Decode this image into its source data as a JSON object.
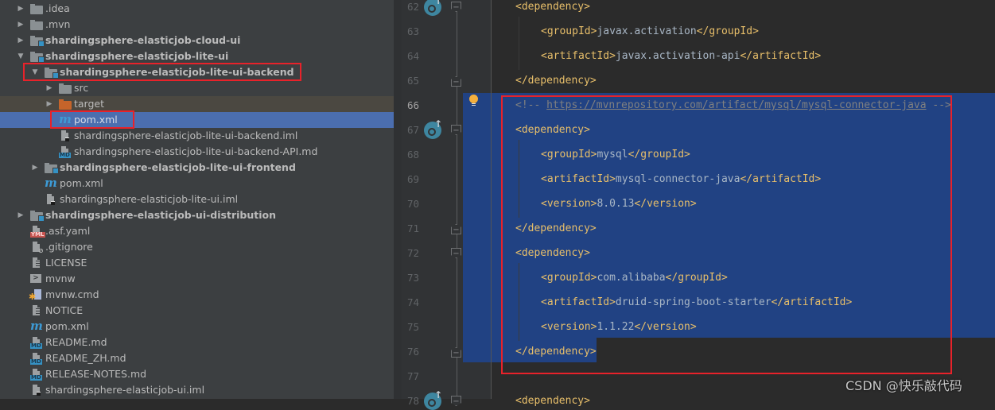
{
  "tree": {
    "items": [
      {
        "label": ".idea",
        "icon": "folder-icon",
        "depth": 1,
        "expanded": false,
        "bold": false
      },
      {
        "label": ".mvn",
        "icon": "folder-icon",
        "depth": 1,
        "expanded": false,
        "bold": false
      },
      {
        "label": "shardingsphere-elasticjob-cloud-ui",
        "icon": "module-folder-icon",
        "depth": 1,
        "expanded": false,
        "bold": true
      },
      {
        "label": "shardingsphere-elasticjob-lite-ui",
        "icon": "module-folder-icon",
        "depth": 1,
        "expanded": true,
        "bold": true
      },
      {
        "label": "shardingsphere-elasticjob-lite-ui-backend",
        "icon": "module-folder-icon",
        "depth": 2,
        "expanded": true,
        "bold": true
      },
      {
        "label": "src",
        "icon": "folder-icon",
        "depth": 3,
        "expanded": false,
        "bold": false
      },
      {
        "label": "target",
        "icon": "excluded-folder-icon",
        "depth": 3,
        "expanded": false,
        "bold": false
      },
      {
        "label": "pom.xml",
        "icon": "maven-icon",
        "depth": 3,
        "selected": true
      },
      {
        "label": "shardingsphere-elasticjob-lite-ui-backend.iml",
        "icon": "iml-file-icon",
        "depth": 3
      },
      {
        "label": "shardingsphere-elasticjob-lite-ui-backend-API.md",
        "icon": "markdown-file-icon",
        "depth": 3
      },
      {
        "label": "shardingsphere-elasticjob-lite-ui-frontend",
        "icon": "module-folder-icon",
        "depth": 2,
        "expanded": false,
        "bold": true
      },
      {
        "label": "pom.xml",
        "icon": "maven-icon",
        "depth": 2
      },
      {
        "label": "shardingsphere-elasticjob-lite-ui.iml",
        "icon": "iml-file-icon",
        "depth": 2
      },
      {
        "label": "shardingsphere-elasticjob-ui-distribution",
        "icon": "module-folder-icon",
        "depth": 1,
        "expanded": false,
        "bold": true
      },
      {
        "label": ".asf.yaml",
        "icon": "yaml-file-icon",
        "depth": 1
      },
      {
        "label": ".gitignore",
        "icon": "ignore-file-icon",
        "depth": 1
      },
      {
        "label": "LICENSE",
        "icon": "text-file-icon",
        "depth": 1
      },
      {
        "label": "mvnw",
        "icon": "shell-file-icon",
        "depth": 1
      },
      {
        "label": "mvnw.cmd",
        "icon": "cmd-file-icon",
        "depth": 1
      },
      {
        "label": "NOTICE",
        "icon": "text-file-icon",
        "depth": 1
      },
      {
        "label": "pom.xml",
        "icon": "maven-icon",
        "depth": 1
      },
      {
        "label": "README.md",
        "icon": "markdown-file-icon",
        "depth": 1
      },
      {
        "label": "README_ZH.md",
        "icon": "markdown-file-icon",
        "depth": 1
      },
      {
        "label": "RELEASE-NOTES.md",
        "icon": "markdown-file-icon",
        "depth": 1
      },
      {
        "label": "shardingsphere-elasticjob-ui.iml",
        "icon": "iml-file-icon",
        "depth": 1
      }
    ],
    "badges": {
      "md": "MD",
      "yml": "YML",
      "maven": "m",
      "shell": ">",
      "gear": "✱"
    }
  },
  "editor": {
    "current_line": 66,
    "lines": [
      {
        "num": 62,
        "indent": 0,
        "parts": [
          {
            "t": "tag",
            "v": "<dependency>"
          }
        ]
      },
      {
        "num": 63,
        "indent": 1,
        "parts": [
          {
            "t": "tag",
            "v": "<groupId>"
          },
          {
            "t": "text",
            "v": "javax.activation"
          },
          {
            "t": "tag",
            "v": "</groupId>"
          }
        ]
      },
      {
        "num": 64,
        "indent": 1,
        "parts": [
          {
            "t": "tag",
            "v": "<artifactId>"
          },
          {
            "t": "text",
            "v": "javax.activation-api"
          },
          {
            "t": "tag",
            "v": "</artifactId>"
          }
        ]
      },
      {
        "num": 65,
        "indent": 0,
        "parts": [
          {
            "t": "tag",
            "v": "</dependency>"
          }
        ]
      },
      {
        "num": 66,
        "indent": 0,
        "parts": [
          {
            "t": "cmt",
            "v": "<!-- "
          },
          {
            "t": "link",
            "v": "https://mvnrepository.com/artifact/mysql/mysql-connector-java"
          },
          {
            "t": "cmt",
            "v": " -->"
          }
        ]
      },
      {
        "num": 67,
        "indent": 0,
        "parts": [
          {
            "t": "tag",
            "v": "<dependency>"
          }
        ]
      },
      {
        "num": 68,
        "indent": 1,
        "parts": [
          {
            "t": "tag",
            "v": "<groupId>"
          },
          {
            "t": "text",
            "v": "mysql"
          },
          {
            "t": "tag",
            "v": "</groupId>"
          }
        ]
      },
      {
        "num": 69,
        "indent": 1,
        "parts": [
          {
            "t": "tag",
            "v": "<artifactId>"
          },
          {
            "t": "text",
            "v": "mysql-connector-java"
          },
          {
            "t": "tag",
            "v": "</artifactId>"
          }
        ]
      },
      {
        "num": 70,
        "indent": 1,
        "parts": [
          {
            "t": "tag",
            "v": "<version>"
          },
          {
            "t": "text",
            "v": "8.0.13"
          },
          {
            "t": "tag",
            "v": "</version>"
          }
        ]
      },
      {
        "num": 71,
        "indent": 0,
        "parts": [
          {
            "t": "tag",
            "v": "</dependency>"
          }
        ]
      },
      {
        "num": 72,
        "indent": 0,
        "parts": [
          {
            "t": "tag",
            "v": "<dependency>"
          }
        ]
      },
      {
        "num": 73,
        "indent": 1,
        "parts": [
          {
            "t": "tag",
            "v": "<groupId>"
          },
          {
            "t": "text",
            "v": "com.alibaba"
          },
          {
            "t": "tag",
            "v": "</groupId>"
          }
        ]
      },
      {
        "num": 74,
        "indent": 1,
        "parts": [
          {
            "t": "tag",
            "v": "<artifactId>"
          },
          {
            "t": "text",
            "v": "druid-spring-boot-starter"
          },
          {
            "t": "tag",
            "v": "</artifactId>"
          }
        ]
      },
      {
        "num": 75,
        "indent": 1,
        "parts": [
          {
            "t": "tag",
            "v": "<version>"
          },
          {
            "t": "text",
            "v": "1.1.22"
          },
          {
            "t": "tag",
            "v": "</version>"
          }
        ]
      },
      {
        "num": 76,
        "indent": 0,
        "parts": [
          {
            "t": "tag",
            "v": "</dependency>"
          }
        ]
      },
      {
        "num": 77,
        "indent": 0,
        "parts": []
      },
      {
        "num": 78,
        "indent": 0,
        "parts": [
          {
            "t": "tag",
            "v": "<dependency>"
          }
        ]
      }
    ],
    "selected_lines": [
      66,
      76
    ],
    "gutter_markers": {
      "implemented_icon_lines": [
        62,
        67,
        78
      ],
      "fold_start_lines": [
        62,
        67,
        72,
        78
      ],
      "fold_end_lines": [
        65,
        71,
        76
      ],
      "intention_bulb_line": 66
    }
  },
  "watermark": "CSDN @快乐敲代码",
  "colors": {
    "tag": "#e8bf6a",
    "text": "#a9b7c6",
    "comment": "#808080",
    "selection": "#214283",
    "tree_selected": "#4b6eaf",
    "highlight_box": "#e8222a"
  }
}
